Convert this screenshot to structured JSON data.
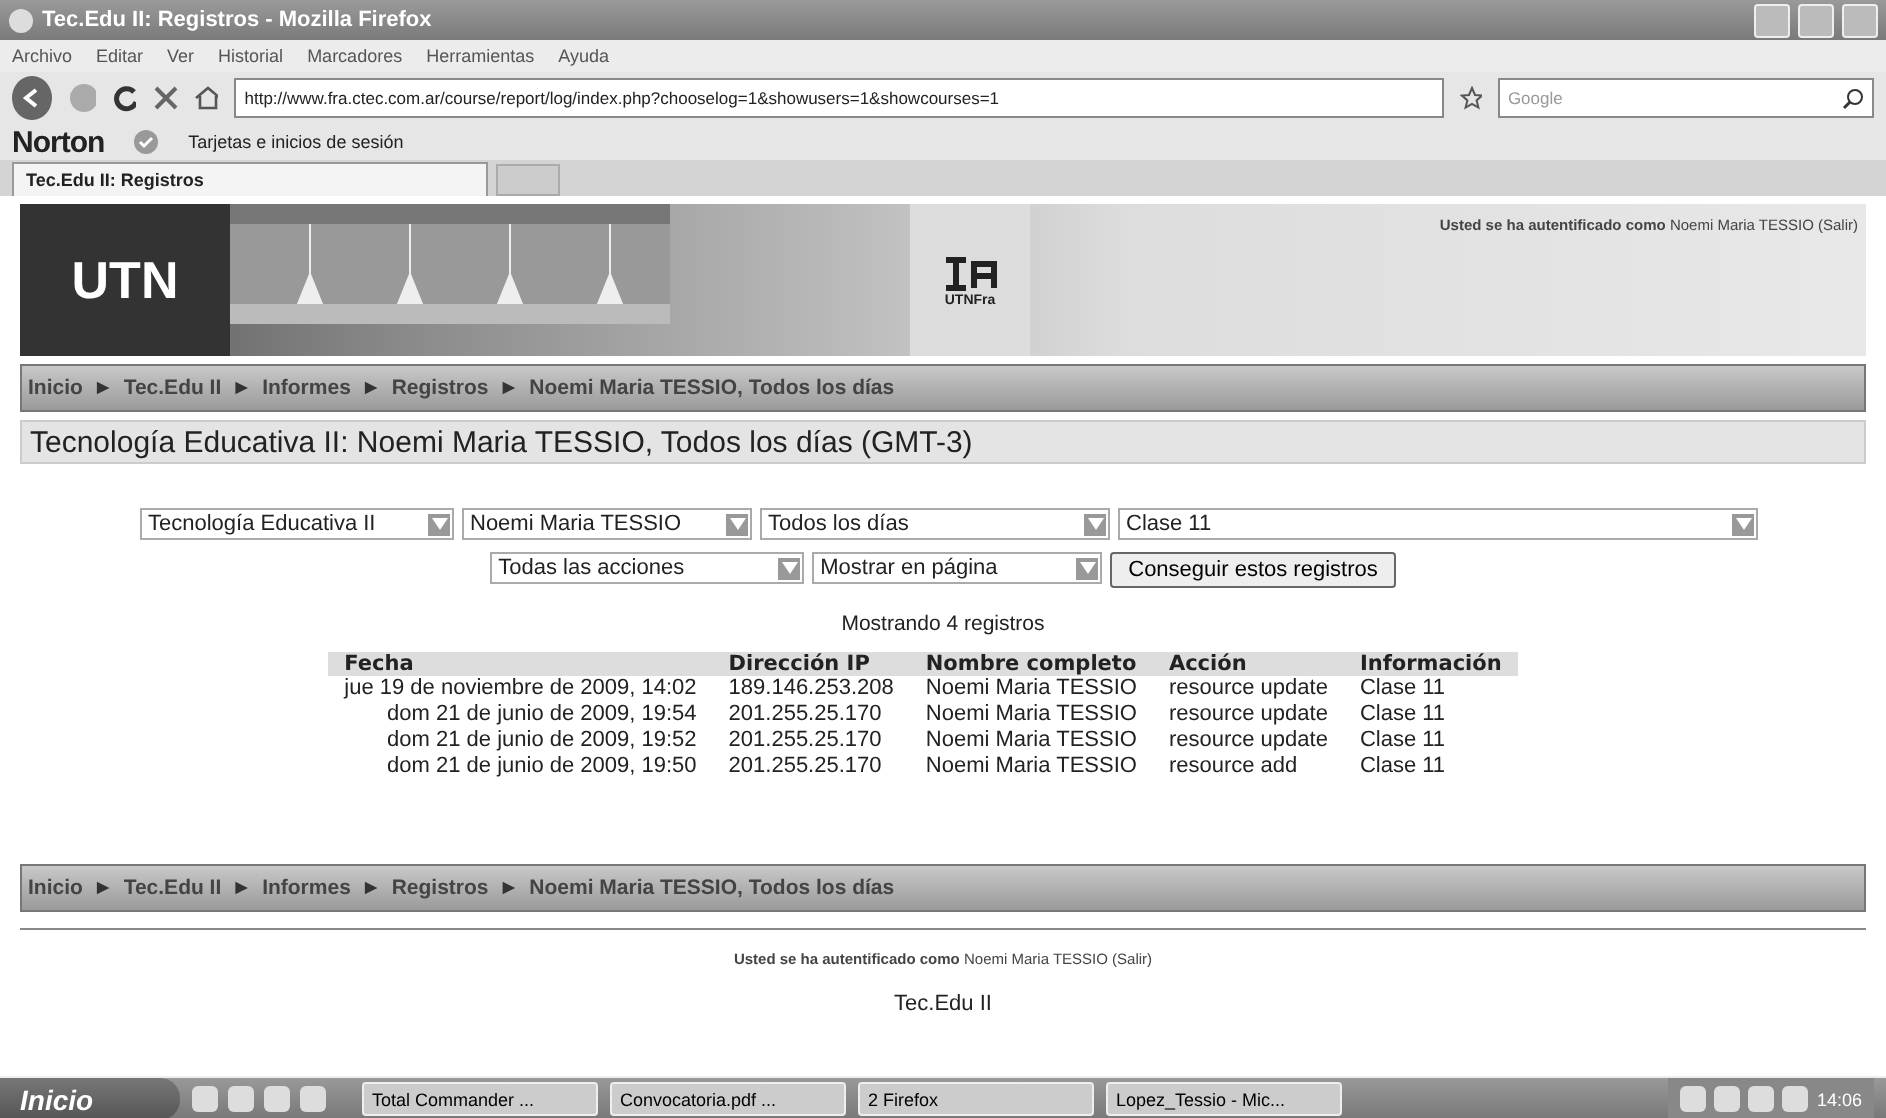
{
  "window": {
    "title": "Tec.Edu II: Registros - Mozilla Firefox"
  },
  "menu": [
    "Archivo",
    "Editar",
    "Ver",
    "Historial",
    "Marcadores",
    "Herramientas",
    "Ayuda"
  ],
  "toolbar": {
    "url": "http://www.fra.ctec.com.ar/course/report/log/index.php?chooselog=1&showusers=1&showcourses=1",
    "search_placeholder": "Google"
  },
  "norton": {
    "brand": "Norton",
    "cards_label": "Tarjetas e inicios de sesión"
  },
  "tabs": [
    {
      "label": "Tec.Edu II: Registros",
      "selected": true
    }
  ],
  "header": {
    "logo_text": "UTN",
    "sub_logo_text": "UTNFra",
    "login_prefix": "Usted se ha autentificado como",
    "login_user": "Noemi Maria TESSIO",
    "login_logout": "(Salir)"
  },
  "breadcrumb": {
    "separator": "►",
    "items": [
      "Inicio",
      "Tec.Edu II",
      "Informes",
      "Registros",
      "Noemi Maria TESSIO, Todos los días"
    ]
  },
  "heading": "Tecnología Educativa II: Noemi Maria TESSIO, Todos los días (GMT-3)",
  "filters": [
    {
      "value": "Tecnología Educativa II"
    },
    {
      "value": "Noemi Maria TESSIO"
    },
    {
      "value": "Todos los días"
    },
    {
      "value": "Clase 11"
    }
  ],
  "filters2": [
    {
      "value": "Todas las acciones"
    },
    {
      "value": "Mostrar en página"
    }
  ],
  "submit": "Conseguir estos registros",
  "status": "Mostrando 4 registros",
  "table": {
    "columns": [
      "Fecha",
      "Dirección IP",
      "Nombre completo",
      "Acción",
      "Información"
    ],
    "rows": [
      [
        "jue 19 de noviembre de 2009, 14:02",
        "189.146.253.208",
        "Noemi Maria TESSIO",
        "resource update",
        "Clase 11"
      ],
      [
        "dom 21 de junio de 2009, 19:54",
        "201.255.25.170",
        "Noemi Maria TESSIO",
        "resource update",
        "Clase 11"
      ],
      [
        "dom 21 de junio de 2009, 19:52",
        "201.255.25.170",
        "Noemi Maria TESSIO",
        "resource update",
        "Clase 11"
      ],
      [
        "dom 21 de junio de 2009, 19:50",
        "201.255.25.170",
        "Noemi Maria TESSIO",
        "resource add",
        "Clase 11"
      ]
    ]
  },
  "footer": {
    "breadcrumb": {
      "separator": "►",
      "items": [
        "Inicio",
        "Tec.Edu II",
        "Informes",
        "Registros",
        "Noemi Maria TESSIO, Todos los días"
      ]
    },
    "login_prefix": "Usted se ha autentificado como",
    "login_user": "Noemi Maria TESSIO",
    "login_logout": "(Salir)",
    "course": "Tec.Edu II"
  },
  "taskbar": {
    "start": "Inicio",
    "tasks": [
      {
        "label": "Total Commander ..."
      },
      {
        "label": "Convocatoria.pdf ..."
      },
      {
        "label": "2 Firefox"
      },
      {
        "label": "Lopez_Tessio - Mic..."
      }
    ],
    "clock": "14:06"
  }
}
